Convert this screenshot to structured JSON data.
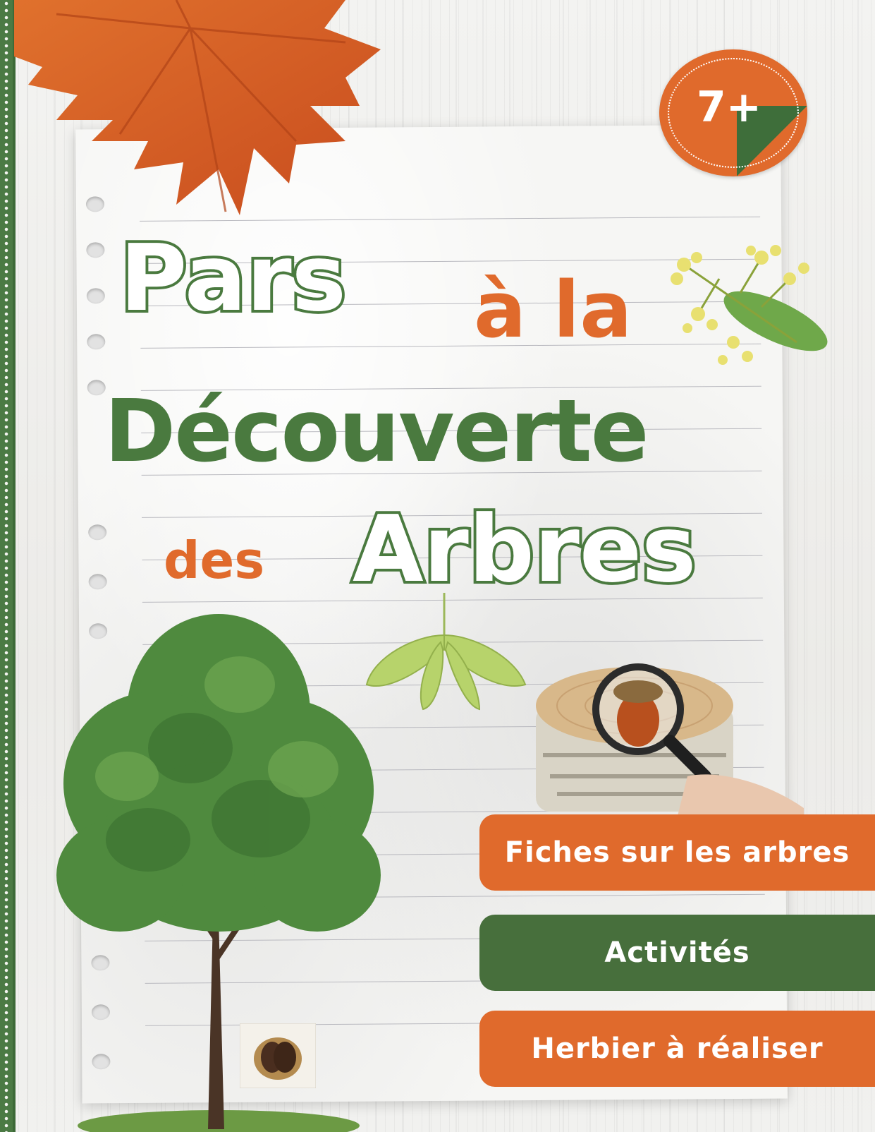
{
  "cover": {
    "title": {
      "line1_word": "Pars",
      "line1_small": "à la",
      "line2": "Découverte",
      "line3_small": "des",
      "line3_word": "Arbres"
    },
    "age_badge": "7+",
    "features": [
      "Fiches sur les arbres",
      "Activités",
      "Herbier à réaliser"
    ]
  },
  "colors": {
    "green": "#4a7a3f",
    "orange": "#e06a2c",
    "paper": "#f6f6f4"
  },
  "icons": {
    "maple_leaf": "maple-leaf-icon",
    "linden_flowers": "linden-flowers-icon",
    "maple_seeds": "maple-seeds-icon",
    "tree": "tree-icon",
    "magnifier": "magnifying-glass-icon",
    "chestnut": "chestnut-icon"
  }
}
